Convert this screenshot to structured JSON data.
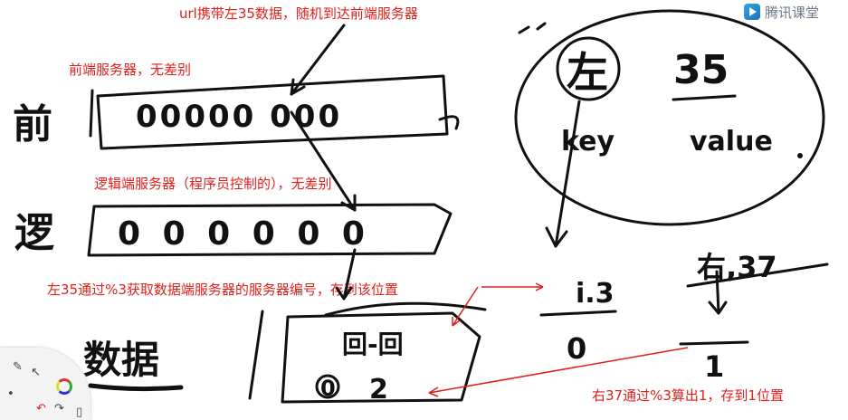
{
  "logo": {
    "text": "腾讯课堂",
    "icon": "play-icon"
  },
  "annotations": {
    "url_note": "url携带左35数据，随机到达前端服务器",
    "frontend_note": "前端服务器，无差别",
    "logic_note": "逻辑端服务器（程序员控制的），无差别",
    "left35_note": "左35通过%3获取数据端服务器的服务器编号，存到该位置",
    "right37_note": "右37通过%3算出1，存到1位置"
  },
  "handwriting": {
    "row_front": "前",
    "row_logic": "逻",
    "row_data": "数据",
    "key_char": "左",
    "value_num": "35",
    "key_label": "key",
    "value_label": "value",
    "i3_label": "i.3",
    "i3_result": "0",
    "right37": "右,37",
    "right_result": "1",
    "front_servers": "00000 000",
    "logic_servers": "0 0 0 0 0 0",
    "data_top": "回-回",
    "data_bottom_0": "0",
    "data_bottom_2": "2"
  },
  "colors": {
    "annotation": "#e0201b",
    "ink": "#111111"
  },
  "toolbar": {
    "icons": [
      "pen-icon",
      "palette-icon",
      "pointer-icon",
      "undo-icon",
      "redo-icon",
      "eraser-icon"
    ]
  }
}
